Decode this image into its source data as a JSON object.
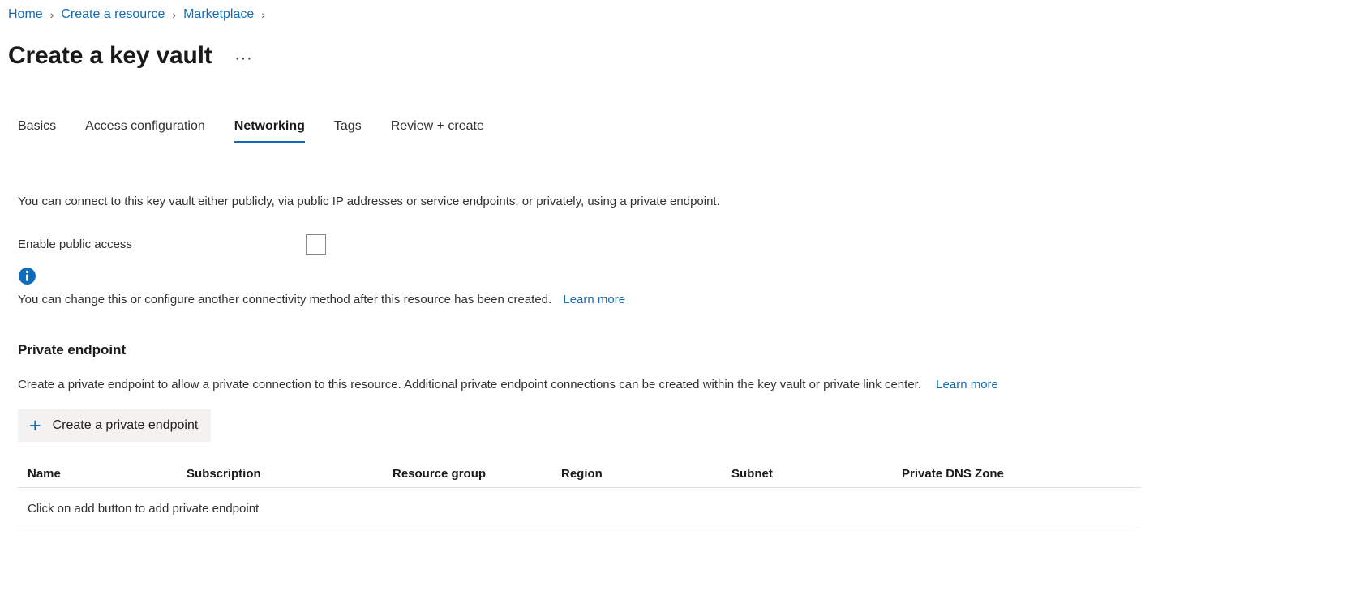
{
  "breadcrumb": {
    "items": [
      {
        "label": "Home"
      },
      {
        "label": "Create a resource"
      },
      {
        "label": "Marketplace"
      }
    ],
    "separator": "›"
  },
  "header": {
    "title": "Create a key vault",
    "more_actions": "···"
  },
  "tabs": [
    {
      "label": "Basics",
      "active": false
    },
    {
      "label": "Access configuration",
      "active": false
    },
    {
      "label": "Networking",
      "active": true
    },
    {
      "label": "Tags",
      "active": false
    },
    {
      "label": "Review + create",
      "active": false
    }
  ],
  "networking": {
    "intro": "You can connect to this key vault either publicly, via public IP addresses or service endpoints, or privately, using a private endpoint.",
    "enable_public_access": {
      "label": "Enable public access",
      "checked": false
    },
    "info": {
      "icon": "info-circle-icon",
      "color": "#0f6cbd",
      "text": "You can change this or configure another connectivity method after this resource has been created.",
      "link_label": "Learn more"
    }
  },
  "private_endpoint": {
    "section_title": "Private endpoint",
    "description": "Create a private endpoint to allow a private connection to this resource. Additional private endpoint connections can be created within the key vault or private link center.",
    "link_label": "Learn more",
    "create_button": {
      "label": "Create a private endpoint",
      "icon": "plus-icon"
    },
    "table": {
      "columns": [
        "Name",
        "Subscription",
        "Resource group",
        "Region",
        "Subnet",
        "Private DNS Zone"
      ],
      "rows": [],
      "empty_message": "Click on add button to add private endpoint"
    }
  }
}
